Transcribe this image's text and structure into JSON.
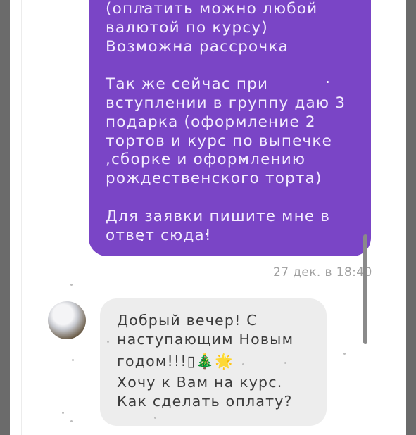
{
  "outgoing_message": {
    "lines": [
      "(оплатить можно любой",
      "валютой по курсу)",
      "Возможна рассрочка",
      "",
      "Так же сейчас при",
      "вступлении в группу даю 3",
      "подарка (оформление 2",
      "тортов и курс по выпечке",
      ",сборке и оформлению",
      "рождественского торта)",
      "",
      "Для заявки пишите мне в",
      "ответ сюда!"
    ]
  },
  "timestamp": "27 дек. в 18:40",
  "incoming_message": {
    "lines": [
      "Добрый вечер! С",
      "наступающим Новым",
      "годом!!!▯🎄🌟",
      "Хочу к Вам на курс.",
      "Как сделать оплату?"
    ]
  },
  "colors": {
    "outgoing_bubble": "#7a45c6",
    "incoming_bubble": "#ededed",
    "timestamp": "#a0a0a0"
  },
  "icons": {
    "avatar": "avatar-image"
  }
}
